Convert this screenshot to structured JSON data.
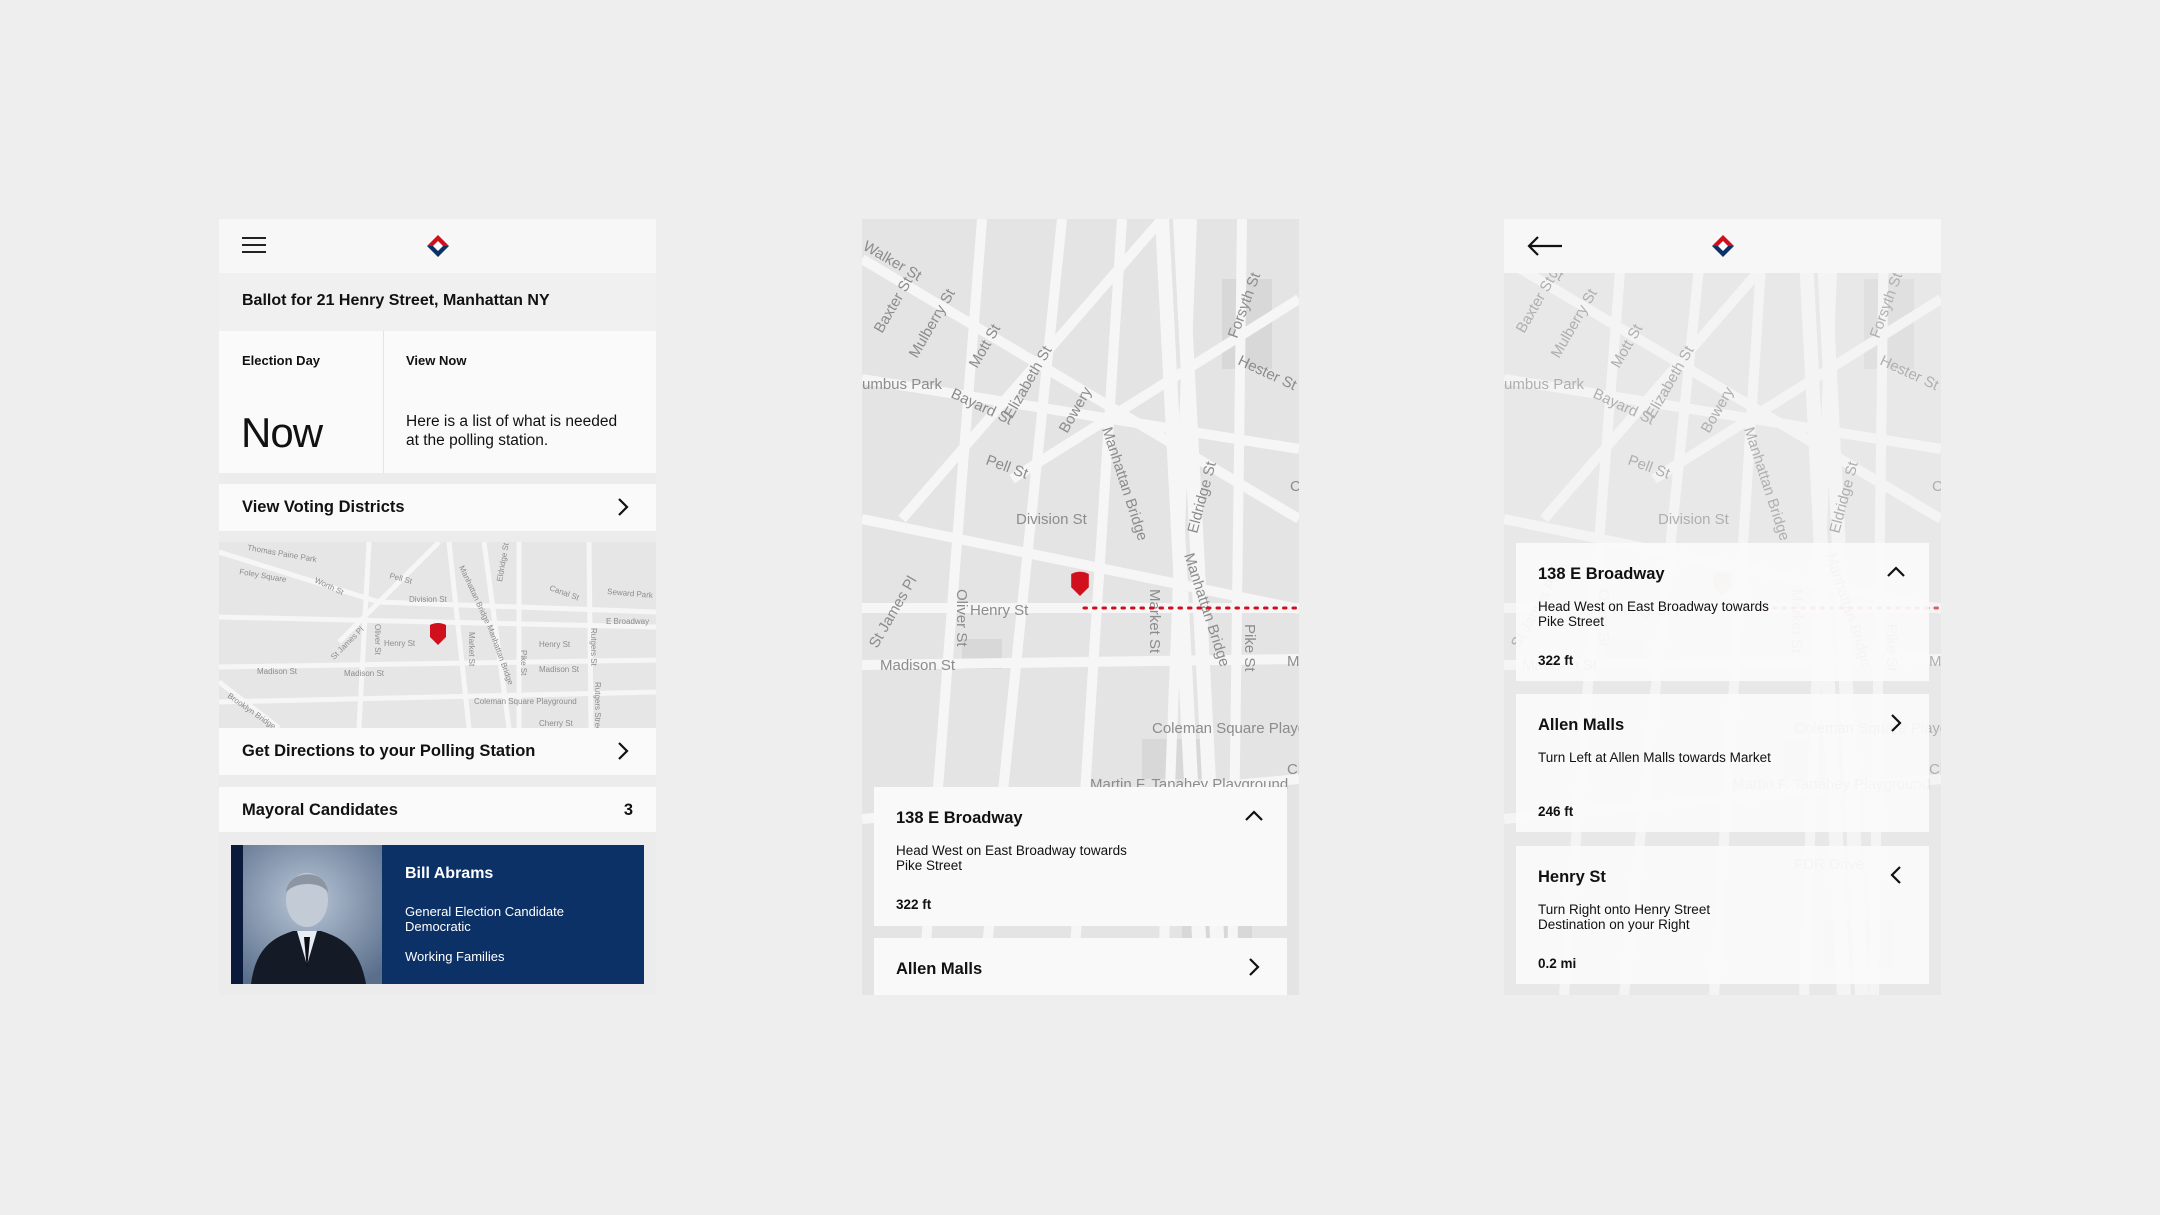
{
  "colors": {
    "accent": "#d0101c",
    "navy": "#0c3166"
  },
  "screen1": {
    "menu_icon": "hamburger-icon",
    "ballot_title": "Ballot for 21 Henry Street, Manhattan NY",
    "election_day_label": "Election Day",
    "election_day_value": "Now",
    "view_now_label": "View Now",
    "view_now_text": "Here is a list of what is needed at the polling station.",
    "voting_districts": "View Voting Districts",
    "directions": "Get Directions to your Polling Station",
    "mayoral_label": "Mayoral Candidates",
    "mayoral_count": "3",
    "candidate": {
      "name": "Bill Abrams",
      "line1": "General Election Candidate",
      "line2": "Democratic",
      "line3": "Working Families"
    },
    "mini_map_labels": [
      "Thomas Paine Park",
      "Foley Square",
      "Worth St",
      "Pell St",
      "Division St",
      "Manhattan Bridge",
      "Eldridge St",
      "Canal St",
      "Seward Park",
      "E Broadway",
      "Henry St",
      "Oliver St",
      "St James Pl",
      "Madison St",
      "Madison St",
      "Market St",
      "Manhattan Bridge",
      "Pike St",
      "Henry St",
      "Madison St",
      "Rutgers St",
      "Rutgers Street",
      "Coleman Square Playground",
      "Cherry St",
      "Brooklyn Bridge"
    ]
  },
  "map": {
    "labels": [
      "Walker St",
      "Baxter St",
      "Mulberry St",
      "Mott St",
      "Elizabeth St",
      "Bayard St",
      "umbus Park",
      "Bowery",
      "Pell St",
      "Division St",
      "Manhattan Bridge",
      "Eldridge St",
      "Forsyth St",
      "Hester St",
      "Henry St",
      "Oliver St",
      "St James Pl",
      "Madison St",
      "Market St",
      "Manhattan Bridge",
      "Pike St",
      "Coleman Square Playground",
      "Ma",
      "Ch",
      "C",
      "Martin F. Tanahey Playground",
      "FDR Drive"
    ]
  },
  "screen2": {
    "steps": [
      {
        "title": "138 E Broadway",
        "desc": "Head West on East Broadway towards Pike Street",
        "dist": "322 ft"
      },
      {
        "title": "Allen Malls"
      }
    ]
  },
  "screen3": {
    "back_icon": "arrow-left-icon",
    "steps": [
      {
        "title": "138 E Broadway",
        "desc": "Head West on East Broadway towards Pike Street",
        "dist": "322 ft"
      },
      {
        "title": "Allen Malls",
        "desc": "Turn Left at Allen Malls towards Market",
        "dist": "246 ft"
      },
      {
        "title": "Henry St",
        "desc": "Turn Right onto Henry Street Destination on your Right",
        "dist": "0.2 mi"
      }
    ]
  }
}
